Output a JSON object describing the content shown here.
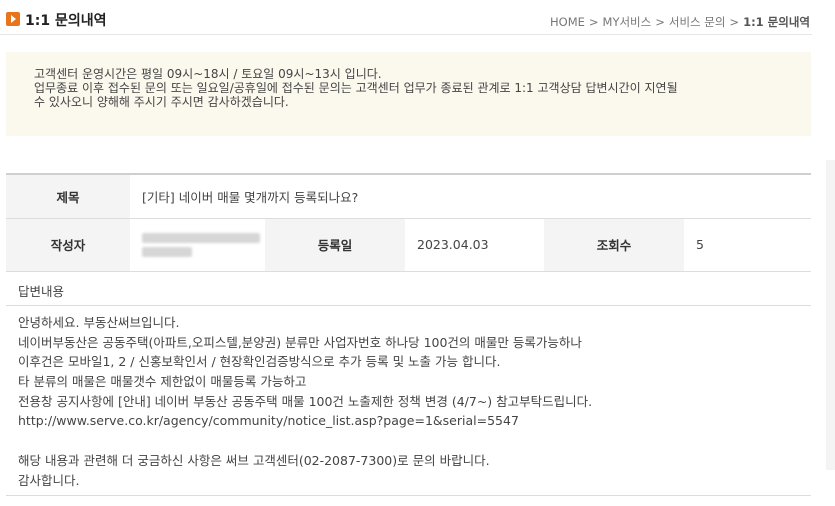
{
  "header": {
    "title": "1:1 문의내역",
    "breadcrumb": [
      "HOME",
      "MY서비스",
      "서비스 문의",
      "1:1 문의내역"
    ]
  },
  "notice": {
    "line1": "고객센터 운영시간은 평일 09시~18시 / 토요일 09시~13시 입니다.",
    "line2": "업무종료 이후 접수된 문의 또는 일요일/공휴일에 접수된 문의는 고객센터 업무가 종료된 관계로 1:1 고객상담 답변시간이 지연될",
    "line3": "수 있사오니 양해해 주시기 주시면 감사하겠습니다."
  },
  "inquiry": {
    "subject_label": "제목",
    "subject": "[기타] 네이버 매물 몇개까지 등록되나요?",
    "author_label": "작성자",
    "date_label": "등록일",
    "date": "2023.04.03",
    "views_label": "조회수",
    "views": "5"
  },
  "answer": {
    "label": "답변내용",
    "lines": [
      "안녕하세요. 부동산써브입니다.",
      "네이버부동산은 공동주택(아파트,오피스텔,분양권) 분류만 사업자번호 하나당 100건의 매물만 등록가능하나",
      "이후건은 모바일1, 2 / 신홍보확인서 / 현장확인검증방식으로 추가 등록 및 노출 가능 합니다.",
      "타 분류의 매물은 매물갯수 제한없이 매물등록 가능하고",
      "전용창 공지사항에 [안내] 네이버 부동산 공동주택 매물 100건 노출제한 정책 변경 (4/7~) 참고부탁드립니다.",
      "http://www.serve.co.kr/agency/community/notice_list.asp?page=1&serial=5547",
      "",
      "해당 내용과 관련해 더 궁금하신 사항은 써브 고객센터(02-2087-7300)로 문의 바랍니다.",
      "감사합니다."
    ]
  },
  "colors": {
    "accent": "#e8741c",
    "notice_bg": "#fbf8ee",
    "header_cell_bg": "#f4f4f4"
  }
}
